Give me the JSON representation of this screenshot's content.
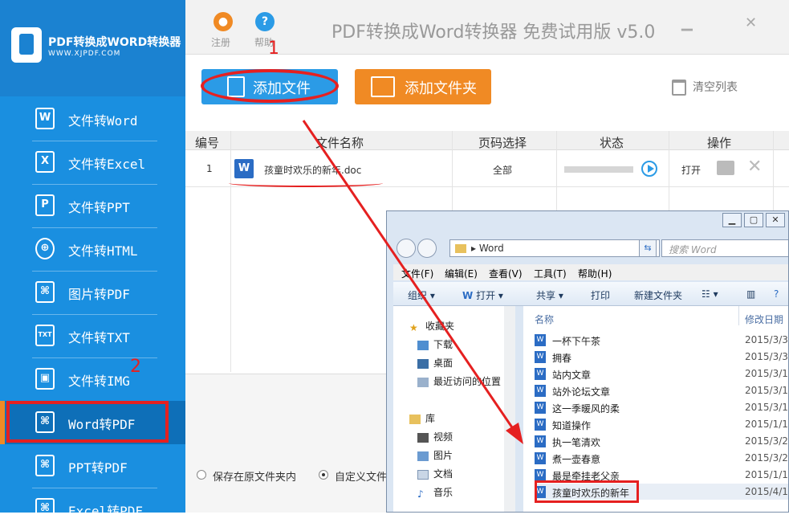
{
  "brand": {
    "title": "PDF转换成WORD转换器",
    "subtitle": "WWW.XJPDF.COM"
  },
  "sidebar": {
    "items": [
      {
        "icon": "word-doc-icon",
        "glyph": "W",
        "label": "文件转Word"
      },
      {
        "icon": "excel-doc-icon",
        "glyph": "X",
        "label": "文件转Excel"
      },
      {
        "icon": "ppt-doc-icon",
        "glyph": "P",
        "label": "文件转PPT"
      },
      {
        "icon": "globe-icon",
        "glyph": "⊕",
        "label": "文件转HTML"
      },
      {
        "icon": "pdf-icon",
        "glyph": "⌘",
        "label": "图片转PDF"
      },
      {
        "icon": "txt-icon",
        "glyph": "TXT",
        "label": "文件转TXT"
      },
      {
        "icon": "image-icon",
        "glyph": "▣",
        "label": "文件转IMG"
      },
      {
        "icon": "pdf-icon",
        "glyph": "⌘",
        "label": "Word转PDF"
      },
      {
        "icon": "pdf-icon",
        "glyph": "⌘",
        "label": "PPT转PDF"
      },
      {
        "icon": "pdf-icon",
        "glyph": "⌘",
        "label": "Excel转PDF"
      }
    ],
    "active_index": 7
  },
  "header": {
    "register_label": "注册",
    "help_label": "帮助",
    "app_title": "PDF转换成Word转换器 免费试用版 v5.0",
    "minimize": "▁",
    "close": "✕"
  },
  "toolbar": {
    "add_file_label": "添加文件",
    "add_folder_label": "添加文件夹",
    "clear_list_label": "清空列表"
  },
  "annotations": {
    "step1": "1",
    "step2": "2"
  },
  "table": {
    "headers": [
      "编号",
      "文件名称",
      "页码选择",
      "状态",
      "操作"
    ],
    "rows": [
      {
        "index": "1",
        "file_name": "孩童时欢乐的新年.doc",
        "pages": "全部",
        "action": "打开",
        "progress_fraction": 0
      }
    ]
  },
  "output": {
    "option_same_folder": "保存在原文件夹内",
    "option_custom": "自定义文件"
  },
  "explorer": {
    "address": "Word",
    "search_placeholder": "搜索 Word",
    "menu": [
      "文件(F)",
      "编辑(E)",
      "查看(V)",
      "工具(T)",
      "帮助(H)"
    ],
    "commands": [
      "组织",
      "打开",
      "共享",
      "打印",
      "新建文件夹"
    ],
    "tree": {
      "favorites": "收藏夹",
      "downloads": "下载",
      "desktop": "桌面",
      "recent": "最近访问的位置",
      "libraries": "库",
      "videos": "视频",
      "pictures": "图片",
      "documents": "文档",
      "music": "音乐"
    },
    "columns": {
      "name": "名称",
      "date": "修改日期"
    },
    "files": [
      {
        "name": "一杯下午茶",
        "date": "2015/3/3"
      },
      {
        "name": "拥春",
        "date": "2015/3/3"
      },
      {
        "name": "站内文章",
        "date": "2015/3/1"
      },
      {
        "name": "站外论坛文章",
        "date": "2015/3/1"
      },
      {
        "name": "这一季暖风的柔",
        "date": "2015/3/1"
      },
      {
        "name": "知道操作",
        "date": "2015/1/1"
      },
      {
        "name": "执一笔清欢",
        "date": "2015/3/2"
      },
      {
        "name": "煮一壶春意",
        "date": "2015/3/2"
      },
      {
        "name": "最是牵挂老父亲",
        "date": "2015/1/1"
      },
      {
        "name": "孩童时欢乐的新年",
        "date": "2015/4/1"
      }
    ]
  }
}
